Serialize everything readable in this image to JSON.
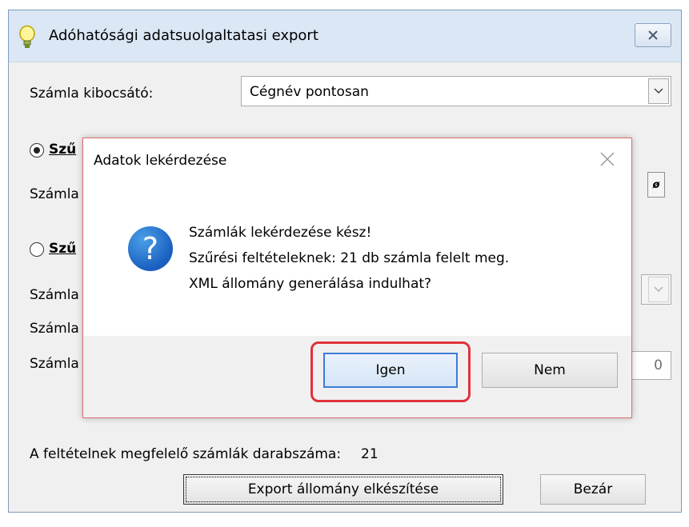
{
  "window": {
    "title": "Adóhatósági  adatsuolgaltatasi export",
    "close_label": "✕"
  },
  "form": {
    "issuer_label": "Számla kibocsátó:",
    "issuer_value": "Cégnév pontosan",
    "radio1_label": "Szű",
    "radio1_checked": true,
    "row1_label": "Számla",
    "small_btn_label": "ø",
    "radio2_label": "Szű",
    "row2_label": "Számla",
    "row3_label": "Számla",
    "row4_label": "Számla",
    "spin_value": "0",
    "count_label": "A feltételnek megfelelő számlák darabszáma:",
    "count_value": "21",
    "export_button": "Export állomány elkészítése",
    "close_button": "Bezár"
  },
  "dialog": {
    "title": "Adatok lekérdezése",
    "icon": "question-icon",
    "message_lines": [
      "Számlák lekérdezése kész!",
      "Szűrési feltételeknek: 21 db számla felelt meg.",
      "XML állomány generálása indulhat?"
    ],
    "yes_button": "Igen",
    "no_button": "Nem",
    "highlight_color": "#e0323a"
  }
}
